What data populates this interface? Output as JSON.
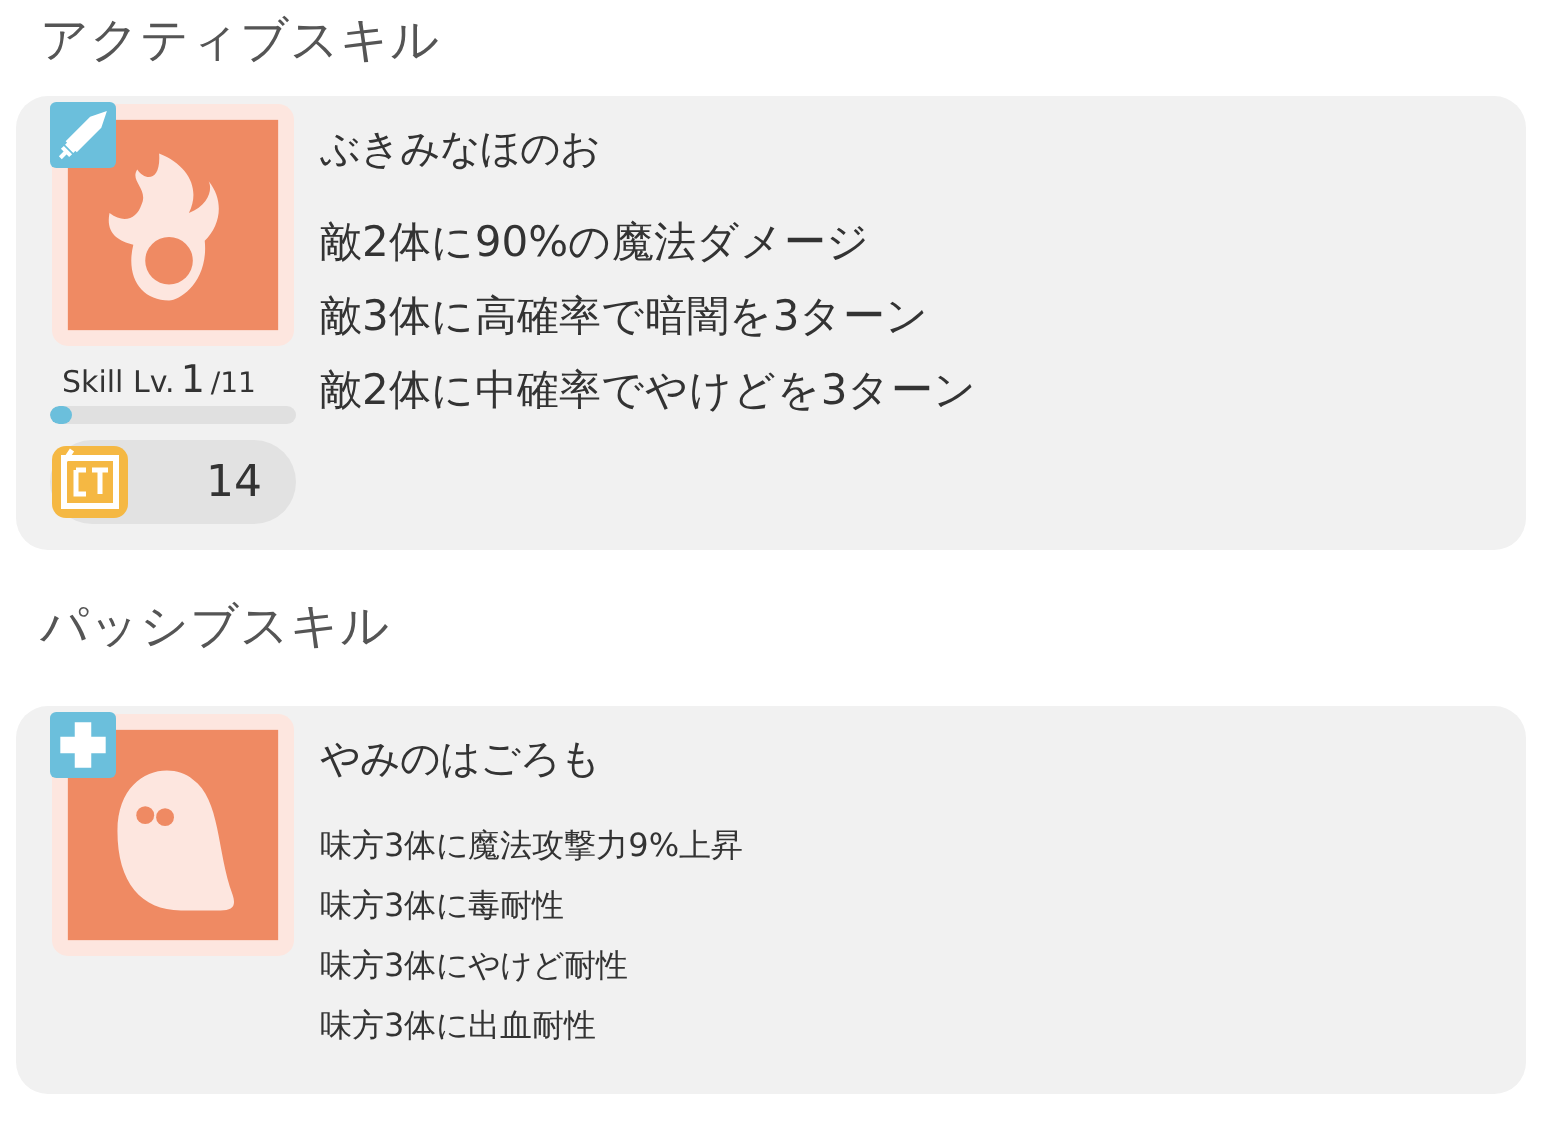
{
  "sections": [
    {
      "title": "アクティブスキル",
      "skill": {
        "kind": "active",
        "name": "ぶきみなほのお",
        "effects": [
          "敵2体に90%の魔法ダメージ",
          "敵3体に高確率で暗闇を3ターン",
          "敵2体に中確率でやけどを3ターン"
        ],
        "level_label": "Skill Lv.",
        "level_value": "1",
        "level_max": "/11",
        "level": 0.09,
        "ct_value": "14"
      }
    },
    {
      "title": "パッシブスキル",
      "skill": {
        "kind": "passive",
        "name": "やみのはごろも",
        "effects": [
          "味方3体に魔法攻撃力9%上昇",
          "味方3体に毒耐性",
          "味方3体にやけど耐性",
          "味方3体に出血耐性"
        ]
      }
    }
  ]
}
